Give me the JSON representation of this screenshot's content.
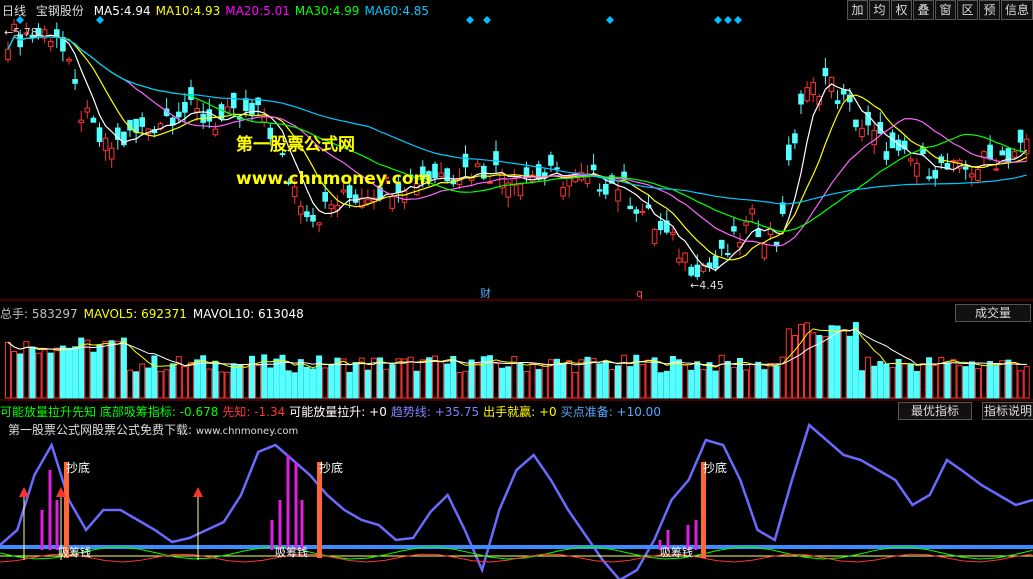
{
  "main": {
    "period": "日线",
    "stock": "宝钢股份",
    "ma": [
      {
        "label": "MA5:",
        "value": "4.94",
        "color": "#ffffff"
      },
      {
        "label": "MA10:",
        "value": "4.93",
        "color": "#ffff00"
      },
      {
        "label": "MA20:",
        "value": "5.01",
        "color": "#ff00ff"
      },
      {
        "label": "MA30:",
        "value": "4.99",
        "color": "#00ff00"
      },
      {
        "label": "MA60:",
        "value": "4.85",
        "color": "#00c8ff"
      }
    ],
    "high_label": "5.78",
    "low_label": "4.45",
    "watermark_title": "第一股票公式网",
    "watermark_url": "www.chnmoney.com",
    "marker_cai": "财",
    "marker_q": "q"
  },
  "toolbar": [
    "加",
    "均",
    "权",
    "叠",
    "窗",
    "区",
    "预",
    "信息"
  ],
  "volume": {
    "items": [
      {
        "label": "总手:",
        "value": "583297",
        "color": "#c0c0c0"
      },
      {
        "label": "MAVOL5:",
        "value": "692371",
        "color": "#ffff00"
      },
      {
        "label": "MAVOL10:",
        "value": "613048",
        "color": "#ffffff"
      }
    ],
    "button": "成交量"
  },
  "indicator": {
    "items": [
      {
        "text": "可能放量拉升先知 底部吸筹指标: -0.678",
        "color": "#00ff00"
      },
      {
        "text": "先知: -1.34",
        "color": "#ff3333"
      },
      {
        "text": "可能放量拉升: +0",
        "color": "#ffffff"
      },
      {
        "text": "趋势线: +35.75",
        "color": "#8080ff"
      },
      {
        "text": "出手就赢: +0",
        "color": "#ffff00"
      },
      {
        "text": "买点准备: +10.00",
        "color": "#55aaff"
      }
    ],
    "btn_best": "最优指标",
    "btn_desc": "指标说明",
    "ad": "第一股票公式网股票公式免费下载:",
    "ad_url": "www.chnmoney.com",
    "chaodi": "抄底",
    "xijian": "吸筹钱"
  }
}
